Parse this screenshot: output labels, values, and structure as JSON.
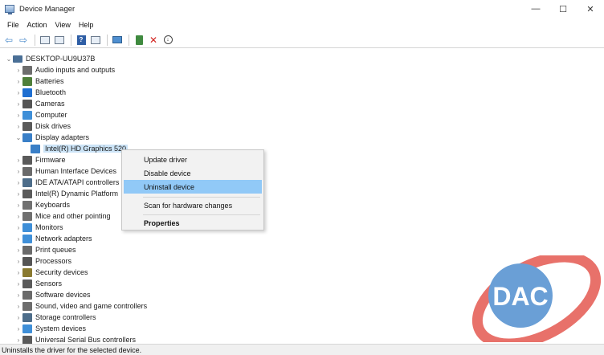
{
  "window": {
    "title": "Device Manager",
    "controls": {
      "minimize": "—",
      "maximize": "☐",
      "close": "✕"
    }
  },
  "menu": [
    "File",
    "Action",
    "View",
    "Help"
  ],
  "toolbar": {
    "icons": [
      "back-arrow-icon",
      "forward-arrow-icon",
      "properties-icon",
      "list-icon",
      "help-icon",
      "view-icon",
      "scan-icon",
      "add-driver-icon",
      "uninstall-icon",
      "download-icon"
    ]
  },
  "tree": {
    "root": "DESKTOP-UU9U37B",
    "items": [
      {
        "label": "Audio inputs and outputs",
        "icon": "speaker-icon",
        "color": "#6d6d6d"
      },
      {
        "label": "Batteries",
        "icon": "battery-icon",
        "color": "#4f7f3a"
      },
      {
        "label": "Bluetooth",
        "icon": "bluetooth-icon",
        "color": "#1f6fd1"
      },
      {
        "label": "Cameras",
        "icon": "camera-icon",
        "color": "#555555"
      },
      {
        "label": "Computer",
        "icon": "computer-icon",
        "color": "#3f8fd8"
      },
      {
        "label": "Disk drives",
        "icon": "disk-icon",
        "color": "#5a5a5a"
      },
      {
        "label": "Display adapters",
        "icon": "display-adapter-icon",
        "color": "#3a7fc7",
        "expanded": true
      },
      {
        "label": "Intel(R) HD Graphics 520",
        "icon": "display-adapter-icon",
        "color": "#3a7fc7",
        "child": true,
        "selected": true
      },
      {
        "label": "Firmware",
        "icon": "firmware-icon",
        "color": "#5a5a5a"
      },
      {
        "label": "Human Interface Devices",
        "icon": "hid-icon",
        "color": "#6a6a6a"
      },
      {
        "label": "IDE ATA/ATAPI controllers",
        "icon": "ide-icon",
        "color": "#4d6d8a"
      },
      {
        "label": "Intel(R) Dynamic Platform",
        "icon": "platform-icon",
        "color": "#5a5a5a"
      },
      {
        "label": "Keyboards",
        "icon": "keyboard-icon",
        "color": "#707070"
      },
      {
        "label": "Mice and other pointing",
        "icon": "mouse-icon",
        "color": "#707070"
      },
      {
        "label": "Monitors",
        "icon": "monitor-icon",
        "color": "#3f8fd8"
      },
      {
        "label": "Network adapters",
        "icon": "network-icon",
        "color": "#3f8fd8"
      },
      {
        "label": "Print queues",
        "icon": "printer-icon",
        "color": "#6a6a6a"
      },
      {
        "label": "Processors",
        "icon": "processor-icon",
        "color": "#555555"
      },
      {
        "label": "Security devices",
        "icon": "security-icon",
        "color": "#8a7a30"
      },
      {
        "label": "Sensors",
        "icon": "sensor-icon",
        "color": "#5a5a5a"
      },
      {
        "label": "Software devices",
        "icon": "software-icon",
        "color": "#6a6a6a"
      },
      {
        "label": "Sound, video and game controllers",
        "icon": "sound-icon",
        "color": "#6d6d6d"
      },
      {
        "label": "Storage controllers",
        "icon": "storage-icon",
        "color": "#4d6d8a"
      },
      {
        "label": "System devices",
        "icon": "system-icon",
        "color": "#3f8fd8"
      },
      {
        "label": "Universal Serial Bus controllers",
        "icon": "usb-icon",
        "color": "#5a5a5a"
      }
    ]
  },
  "context_menu": {
    "items": [
      "Update driver",
      "Disable device",
      "Uninstall device",
      "Scan for hardware changes",
      "Properties"
    ],
    "highlighted": "Uninstall device"
  },
  "status_bar": "Uninstalls the driver for the selected device.",
  "watermark": {
    "text": "DAC",
    "ring_color": "#e8716a",
    "circle_color": "#6a9fd6"
  }
}
